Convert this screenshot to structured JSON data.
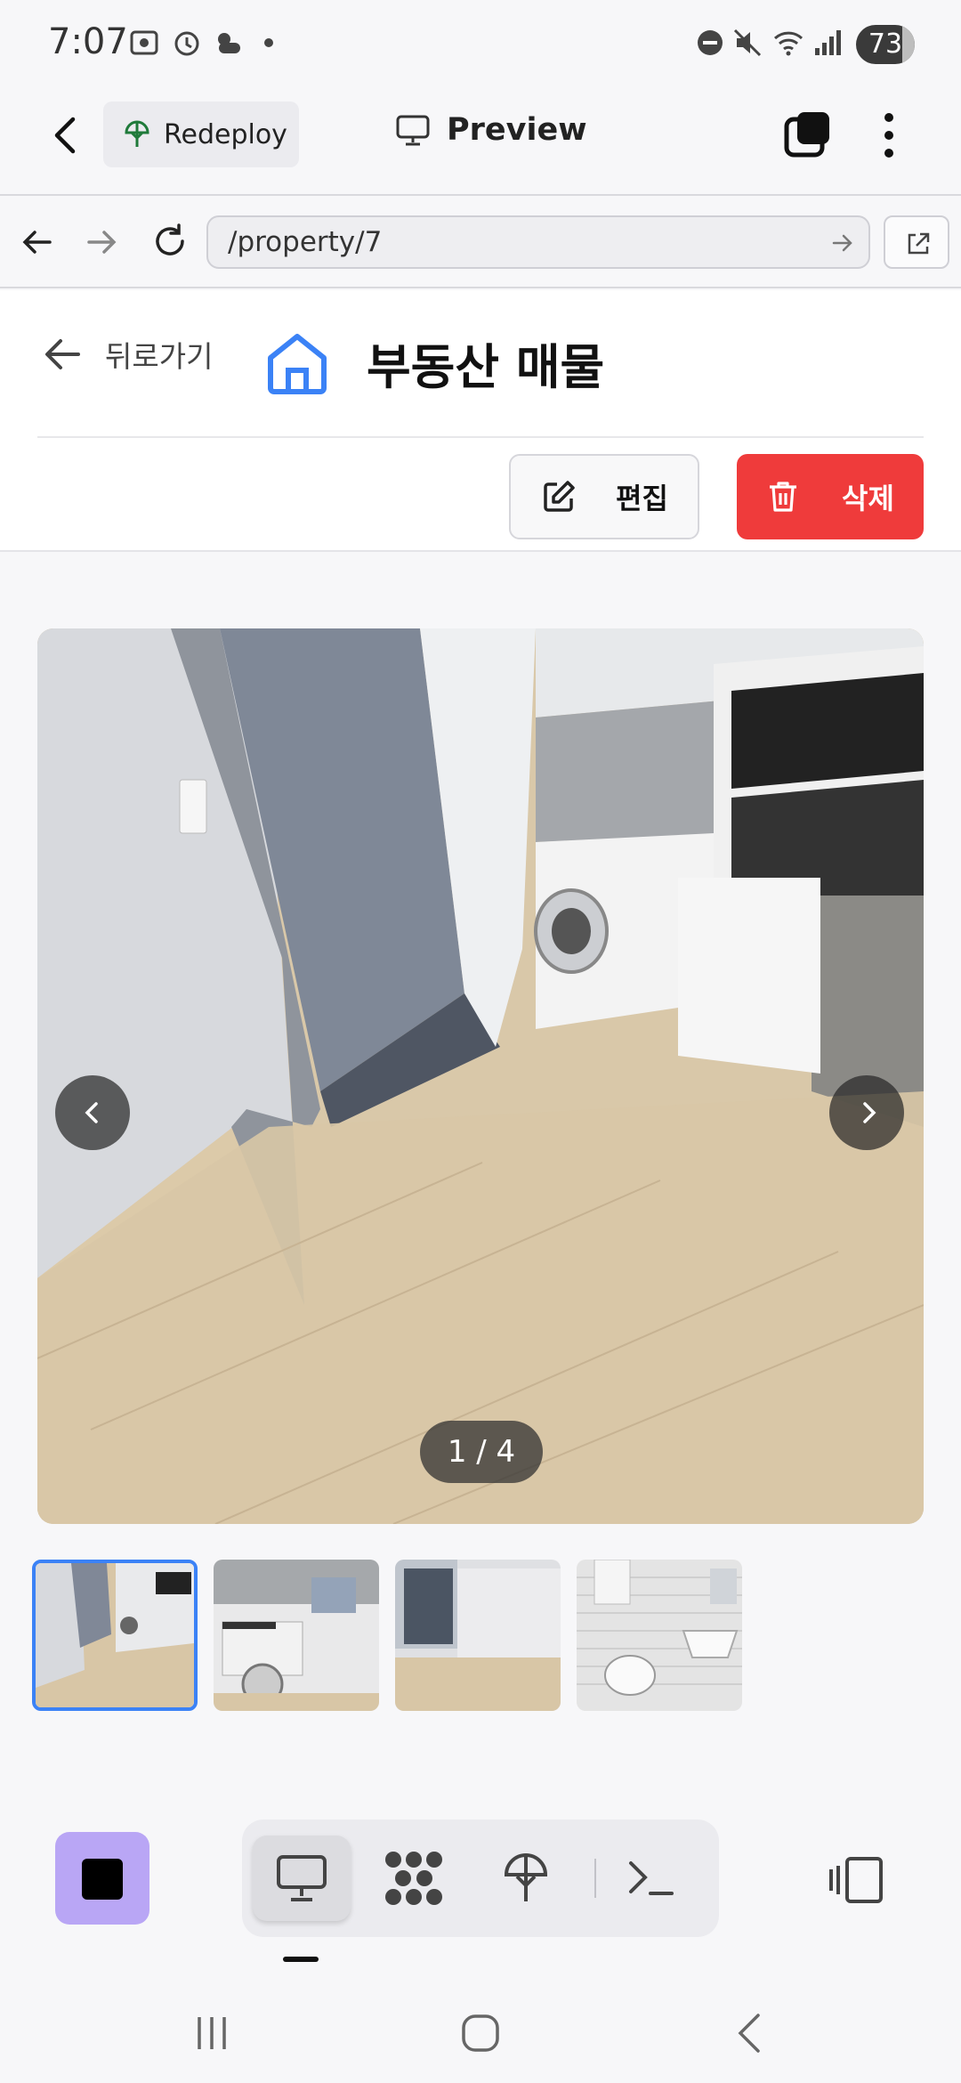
{
  "status_bar": {
    "time": "7:07",
    "battery": "73",
    "icons": [
      "screenshot-icon",
      "alarm-icon",
      "weather-icon",
      "dot-icon",
      "dnd-icon",
      "mute-icon",
      "wifi-icon",
      "signal-icon"
    ]
  },
  "toolbar": {
    "redeploy_label": "Redeploy",
    "preview_label": "Preview"
  },
  "url_bar": {
    "url": "/property/7"
  },
  "page": {
    "back_label": "뒤로가기",
    "title": "부동산 매물",
    "edit_label": "편집",
    "delete_label": "삭제",
    "accent_color": "#3b82f6",
    "delete_color": "#ef3b3b"
  },
  "gallery": {
    "counter": "1 / 4",
    "thumbnails": [
      "room-kitchen",
      "kitchen-washer",
      "room-window",
      "bathroom"
    ],
    "active_index": 0
  },
  "dock": {
    "tabs": [
      "preview-tab",
      "graph-tab",
      "deploy-tab",
      "terminal-tab"
    ],
    "active_tab": 0
  }
}
